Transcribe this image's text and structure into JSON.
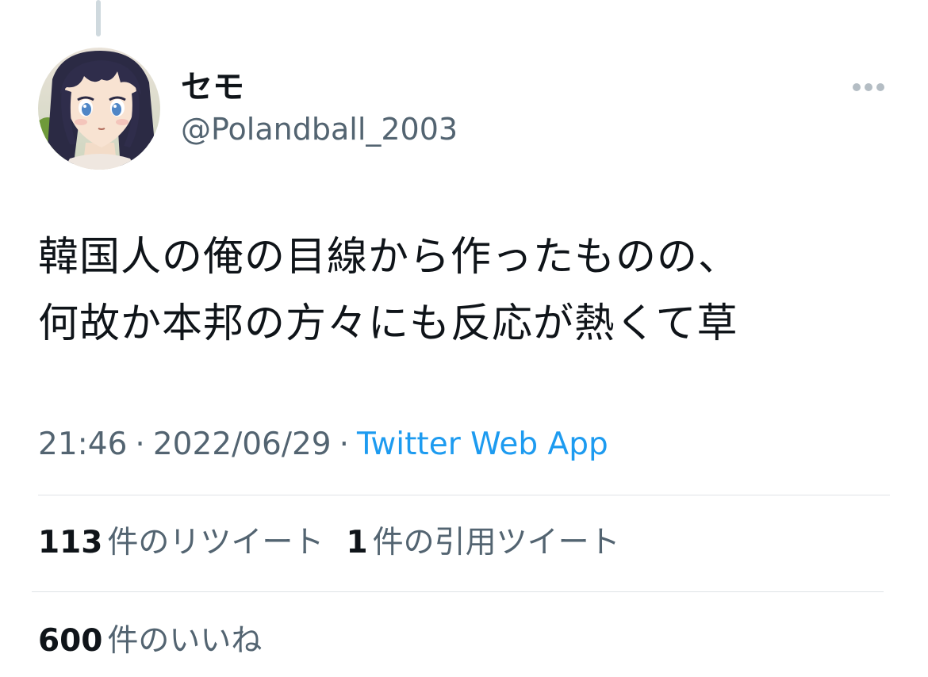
{
  "tweet": {
    "display_name": "セモ",
    "handle": "@Polandball_2003",
    "text_lines": [
      "韓国人の俺の目線から作ったものの、",
      "何故か本邦の方々にも反応が熱くて草"
    ],
    "time": "21:46",
    "date": "2022/06/29",
    "separator": "·",
    "source": "Twitter Web App",
    "avatar_icon": "anime-girl-avatar",
    "more_icon": "more-horizontal-icon"
  },
  "stats": {
    "retweets": {
      "count": "113",
      "label": "件のリツイート"
    },
    "quotes": {
      "count": "1",
      "label": "件の引用ツイート"
    },
    "likes": {
      "count": "600",
      "label": "件のいいね"
    }
  },
  "colors": {
    "text_primary": "#0f1419",
    "text_secondary": "#536471",
    "link": "#1d9bf0",
    "divider": "#dfe3e6"
  }
}
